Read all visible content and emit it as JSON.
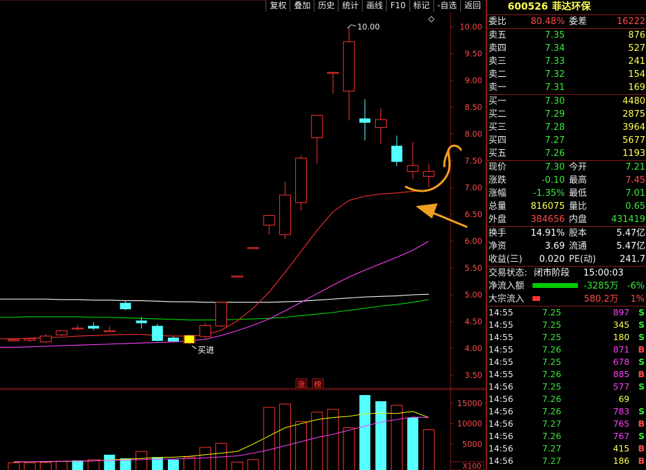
{
  "toolbar": [
    {
      "label": "复权",
      "name": "toolbar-fuquan-button"
    },
    {
      "label": "叠加",
      "name": "toolbar-overlay-button"
    },
    {
      "label": "历史",
      "name": "toolbar-history-button"
    },
    {
      "label": "统计",
      "name": "toolbar-stats-button"
    },
    {
      "label": "画线",
      "name": "toolbar-draw-line-button"
    },
    {
      "label": "F10",
      "name": "toolbar-f10-button"
    },
    {
      "label": "标记",
      "name": "toolbar-mark-button"
    },
    {
      "label": "-自选",
      "name": "toolbar-remove-watchlist-button"
    },
    {
      "label": "返回",
      "name": "toolbar-back-button"
    }
  ],
  "stock": {
    "code": "600526",
    "name": "菲达环保"
  },
  "weibi": {
    "label": "委比",
    "value": "80.48%",
    "label2": "委差",
    "value2": "16222"
  },
  "sells": [
    {
      "label": "卖五",
      "price": "7.35",
      "vol": "876"
    },
    {
      "label": "卖四",
      "price": "7.34",
      "vol": "527"
    },
    {
      "label": "卖三",
      "price": "7.33",
      "vol": "241"
    },
    {
      "label": "卖二",
      "price": "7.32",
      "vol": "154"
    },
    {
      "label": "卖一",
      "price": "7.31",
      "vol": "169"
    }
  ],
  "buys": [
    {
      "label": "买一",
      "price": "7.30",
      "vol": "4480"
    },
    {
      "label": "买二",
      "price": "7.29",
      "vol": "2875"
    },
    {
      "label": "买三",
      "price": "7.28",
      "vol": "3964"
    },
    {
      "label": "买四",
      "price": "7.27",
      "vol": "5677"
    },
    {
      "label": "买五",
      "price": "7.26",
      "vol": "1193"
    }
  ],
  "quote": [
    {
      "l1": "现价",
      "v1": "7.30",
      "l2": "今开",
      "v2": "7.21",
      "c1": "grn",
      "c2": "grn"
    },
    {
      "l1": "涨跌",
      "v1": "-0.10",
      "l2": "最高",
      "v2": "7.45",
      "c1": "grn",
      "c2": "red"
    },
    {
      "l1": "涨幅",
      "v1": "-1.35%",
      "l2": "最低",
      "v2": "7.01",
      "c1": "grn",
      "c2": "grn"
    },
    {
      "l1": "总量",
      "v1": "816075",
      "l2": "量比",
      "v2": "0.65",
      "c1": "yel",
      "c2": "grn"
    },
    {
      "l1": "外盘",
      "v1": "384656",
      "l2": "内盘",
      "v2": "431419",
      "c1": "red",
      "c2": "grn"
    }
  ],
  "fund": [
    {
      "l1": "换手",
      "v1": "14.91%",
      "l2": "股本",
      "v2": "5.47亿"
    },
    {
      "l1": "净资",
      "v1": "3.69",
      "l2": "流通",
      "v2": "5.47亿"
    },
    {
      "l1": "收益(三)",
      "v1": "0.020",
      "l2": "PE(动)",
      "v2": "241.7"
    }
  ],
  "trade_status": {
    "label": "交易状态:",
    "state": "闭市阶段",
    "time": "15:00:03"
  },
  "net_inflow": {
    "label": "净流入额",
    "amount": "-3285万",
    "pct": "-6%",
    "bar_color": "#00cc00",
    "bar_fraction": 0.6
  },
  "block_inflow": {
    "label": "大宗流入",
    "amount": "580.2万",
    "pct": "1%",
    "bar_color": "#ff3333",
    "bar_fraction": 0.1
  },
  "ticks": [
    {
      "time": "14:55",
      "price": "7.25",
      "vol": "897",
      "flag": "S",
      "pc": "grn",
      "vc": "mag"
    },
    {
      "time": "14:55",
      "price": "7.25",
      "vol": "345",
      "flag": "S",
      "pc": "grn",
      "vc": "yel"
    },
    {
      "time": "14:55",
      "price": "7.25",
      "vol": "180",
      "flag": "S",
      "pc": "grn",
      "vc": "yel"
    },
    {
      "time": "14:55",
      "price": "7.26",
      "vol": "871",
      "flag": "B",
      "pc": "grn",
      "vc": "mag"
    },
    {
      "time": "14:55",
      "price": "7.25",
      "vol": "678",
      "flag": "S",
      "pc": "grn",
      "vc": "mag"
    },
    {
      "time": "14:55",
      "price": "7.26",
      "vol": "885",
      "flag": "B",
      "pc": "grn",
      "vc": "mag"
    },
    {
      "time": "14:56",
      "price": "7.25",
      "vol": "577",
      "flag": "S",
      "pc": "grn",
      "vc": "mag"
    },
    {
      "time": "14:56",
      "price": "7.26",
      "vol": "69",
      "flag": "",
      "pc": "grn",
      "vc": "yel"
    },
    {
      "time": "14:56",
      "price": "7.26",
      "vol": "783",
      "flag": "S",
      "pc": "grn",
      "vc": "mag"
    },
    {
      "time": "14:56",
      "price": "7.27",
      "vol": "765",
      "flag": "B",
      "pc": "grn",
      "vc": "mag"
    },
    {
      "time": "14:56",
      "price": "7.26",
      "vol": "767",
      "flag": "S",
      "pc": "grn",
      "vc": "mag"
    },
    {
      "time": "14:56",
      "price": "7.27",
      "vol": "415",
      "flag": "B",
      "pc": "grn",
      "vc": "yel"
    },
    {
      "time": "14:56",
      "price": "7.27",
      "vol": "186",
      "flag": "B",
      "pc": "grn",
      "vc": "yel"
    }
  ],
  "colors": {
    "up": "#ff3232",
    "down": "#54ffff",
    "ma5": "#ffffff",
    "ma10": "#ffff00",
    "ma20": "#ff40ff",
    "ma60": "#00e000",
    "ma120": "#ff3030"
  },
  "annotations": {
    "buy_label": "买进",
    "limit_up_1": "涨",
    "limit_up_2": "榜",
    "peak_label": "10.00",
    "vol_unit": "X100"
  },
  "chart_data": [
    {
      "type": "candlestick",
      "y_axis_ticks": [
        "10.00",
        "9.50",
        "9.00",
        "8.50",
        "8.00",
        "7.50",
        "7.00",
        "6.50",
        "6.00",
        "5.50",
        "5.00",
        "4.50",
        "4.00",
        "3.50"
      ],
      "ylim": [
        3.3,
        10.1
      ],
      "candles": [
        {
          "o": 4.16,
          "h": 4.19,
          "l": 4.14,
          "c": 4.16
        },
        {
          "o": 4.15,
          "h": 4.19,
          "l": 4.12,
          "c": 4.18
        },
        {
          "o": 4.12,
          "h": 4.27,
          "l": 4.1,
          "c": 4.23
        },
        {
          "o": 4.25,
          "h": 4.33,
          "l": 4.23,
          "c": 4.33
        },
        {
          "o": 4.38,
          "h": 4.44,
          "l": 4.33,
          "c": 4.38
        },
        {
          "o": 4.42,
          "h": 4.49,
          "l": 4.33,
          "c": 4.37
        },
        {
          "o": 4.33,
          "h": 4.42,
          "l": 4.31,
          "c": 4.33
        },
        {
          "o": 4.85,
          "h": 4.9,
          "l": 4.71,
          "c": 4.73
        },
        {
          "o": 4.52,
          "h": 4.58,
          "l": 4.37,
          "c": 4.47
        },
        {
          "o": 4.42,
          "h": 4.46,
          "l": 4.13,
          "c": 4.14
        },
        {
          "o": 4.2,
          "h": 4.22,
          "l": 4.13,
          "c": 4.13
        },
        {
          "o": 4.1,
          "h": 4.26,
          "l": 4.07,
          "c": 4.24
        },
        {
          "o": 4.22,
          "h": 4.48,
          "l": 4.18,
          "c": 4.43
        },
        {
          "o": 4.42,
          "h": 4.86,
          "l": 4.4,
          "c": 4.86
        },
        {
          "o": 5.35,
          "h": 5.35,
          "l": 5.35,
          "c": 5.35
        },
        {
          "o": 5.88,
          "h": 5.88,
          "l": 5.88,
          "c": 5.88
        },
        {
          "o": 6.3,
          "h": 6.48,
          "l": 6.12,
          "c": 6.48
        },
        {
          "o": 6.12,
          "h": 7.11,
          "l": 6.04,
          "c": 6.86
        },
        {
          "o": 6.72,
          "h": 7.6,
          "l": 6.57,
          "c": 7.55
        },
        {
          "o": 7.93,
          "h": 8.35,
          "l": 7.45,
          "c": 8.35
        },
        {
          "o": 9.15,
          "h": 9.15,
          "l": 8.75,
          "c": 9.15
        },
        {
          "o": 8.8,
          "h": 10.0,
          "l": 8.25,
          "c": 9.72
        },
        {
          "o": 8.29,
          "h": 8.65,
          "l": 7.88,
          "c": 8.21
        },
        {
          "o": 8.12,
          "h": 8.48,
          "l": 7.82,
          "c": 8.27
        },
        {
          "o": 7.78,
          "h": 7.97,
          "l": 7.4,
          "c": 7.48
        },
        {
          "o": 7.3,
          "h": 7.85,
          "l": 7.16,
          "c": 7.41
        },
        {
          "o": 7.21,
          "h": 7.45,
          "l": 7.01,
          "c": 7.3
        }
      ],
      "ma_lines": [
        {
          "color": "#ffffff",
          "values": [
            4.92,
            4.92,
            4.92,
            4.91,
            4.91,
            4.9,
            4.9,
            4.89,
            4.89,
            4.88,
            4.87,
            4.87,
            4.86,
            4.86,
            4.86,
            4.86,
            4.86,
            4.87,
            4.88,
            4.9,
            4.92,
            4.94,
            4.96,
            4.97,
            4.98,
            5.0,
            5.01
          ]
        },
        {
          "color": "#00e000",
          "values": [
            4.58,
            4.59,
            4.59,
            4.59,
            4.59,
            4.58,
            4.58,
            4.57,
            4.56,
            4.55,
            4.54,
            4.53,
            4.53,
            4.53,
            4.54,
            4.55,
            4.56,
            4.58,
            4.61,
            4.64,
            4.67,
            4.71,
            4.75,
            4.79,
            4.82,
            4.86,
            4.91
          ]
        },
        {
          "color": "#ff40ff",
          "values": [
            4.02,
            4.03,
            4.04,
            4.05,
            4.06,
            4.07,
            4.08,
            4.09,
            4.1,
            4.11,
            4.12,
            4.14,
            4.17,
            4.24,
            4.33,
            4.43,
            4.55,
            4.7,
            4.86,
            5.02,
            5.18,
            5.33,
            5.46,
            5.58,
            5.7,
            5.83,
            6.0
          ]
        },
        {
          "color": "#ff3030",
          "values": [
            4.18,
            4.19,
            4.2,
            4.21,
            4.23,
            4.24,
            4.25,
            4.26,
            4.26,
            4.24,
            4.23,
            4.23,
            4.25,
            4.34,
            4.51,
            4.75,
            5.05,
            5.42,
            5.81,
            6.2,
            6.55,
            6.76,
            6.84,
            6.88,
            6.9,
            6.93,
            6.95
          ]
        }
      ],
      "limit_up_marks": [
        "涨",
        "榜"
      ]
    },
    {
      "type": "bar",
      "y_axis_ticks": [
        "15000",
        "10000",
        "5000"
      ],
      "ylim": [
        0,
        17500
      ],
      "unit_label": "X100",
      "values": [
        400,
        400,
        500,
        800,
        1000,
        1200,
        2400,
        1500,
        3200,
        1800,
        1200,
        1800,
        4200,
        5200,
        600,
        1200,
        14000,
        14800,
        10500,
        12800,
        13500,
        9000,
        17000,
        15500,
        14500,
        11500,
        8500
      ],
      "bar_up": [
        true,
        true,
        true,
        true,
        false,
        true,
        false,
        false,
        true,
        false,
        false,
        true,
        true,
        true,
        true,
        true,
        true,
        true,
        true,
        true,
        true,
        true,
        false,
        false,
        true,
        false,
        true
      ],
      "avg_lines": [
        {
          "color": "#ffff00",
          "values": [
            600,
            650,
            700,
            750,
            800,
            900,
            1100,
            1300,
            1500,
            1700,
            1800,
            2000,
            2400,
            2800,
            3200,
            5000,
            7000,
            9000,
            10000,
            11000,
            11500,
            11800,
            12400,
            12600,
            12500,
            13000,
            11500
          ]
        },
        {
          "color": "#ff40ff",
          "values": [
            700,
            700,
            750,
            800,
            850,
            900,
            1000,
            1100,
            1200,
            1300,
            1350,
            1450,
            1650,
            1850,
            2100,
            2800,
            3600,
            4600,
            5600,
            6600,
            7400,
            8400,
            9400,
            10400,
            11000,
            11600,
            11500
          ]
        }
      ]
    }
  ]
}
